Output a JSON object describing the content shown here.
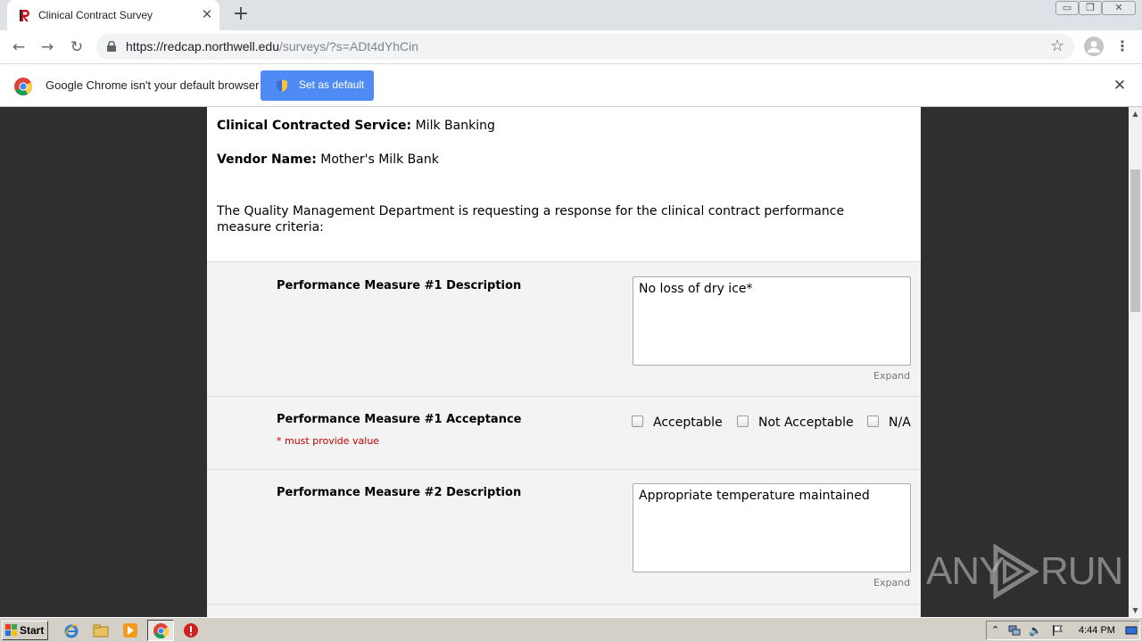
{
  "browser": {
    "tab_title": "Clinical Contract Survey",
    "tab_close": "✕",
    "new_tab": "+",
    "url_host": "https://redcap.northwell.edu",
    "url_path": "/surveys/?s=ADt4dYhCin",
    "window_buttons": [
      "▭",
      "❐",
      "✕"
    ]
  },
  "infobar": {
    "message": "Google Chrome isn't your default browser",
    "button_label": "Set as default",
    "close": "✕"
  },
  "survey": {
    "service_label": "Clinical Contracted Service:",
    "service_value": "Milk Banking",
    "vendor_label": "Vendor Name:",
    "vendor_value": "Mother's Milk Bank",
    "intro": "The Quality Management Department is requesting a response for the clinical contract performance measure criteria:",
    "pm1_desc_label": "Performance Measure #1 Description",
    "pm1_desc_value": "No loss of dry ice*",
    "pm1_accept_label": "Performance Measure #1 Acceptance",
    "required_note": "* must provide value",
    "options": [
      "Acceptable",
      "Not Acceptable",
      "N/A"
    ],
    "pm2_desc_label": "Performance Measure #2 Description",
    "pm2_desc_value": "Appropriate temperature maintained",
    "expand_label": "Expand"
  },
  "watermark": {
    "left": "ANY",
    "right": "RUN"
  },
  "taskbar": {
    "start_label": "Start",
    "clock": "4:44 PM"
  },
  "colors": {
    "accent_button": "#4f8bf5",
    "required_red": "#c00000",
    "page_background": "#2f2f2f",
    "row_background": "#f3f3f3"
  }
}
